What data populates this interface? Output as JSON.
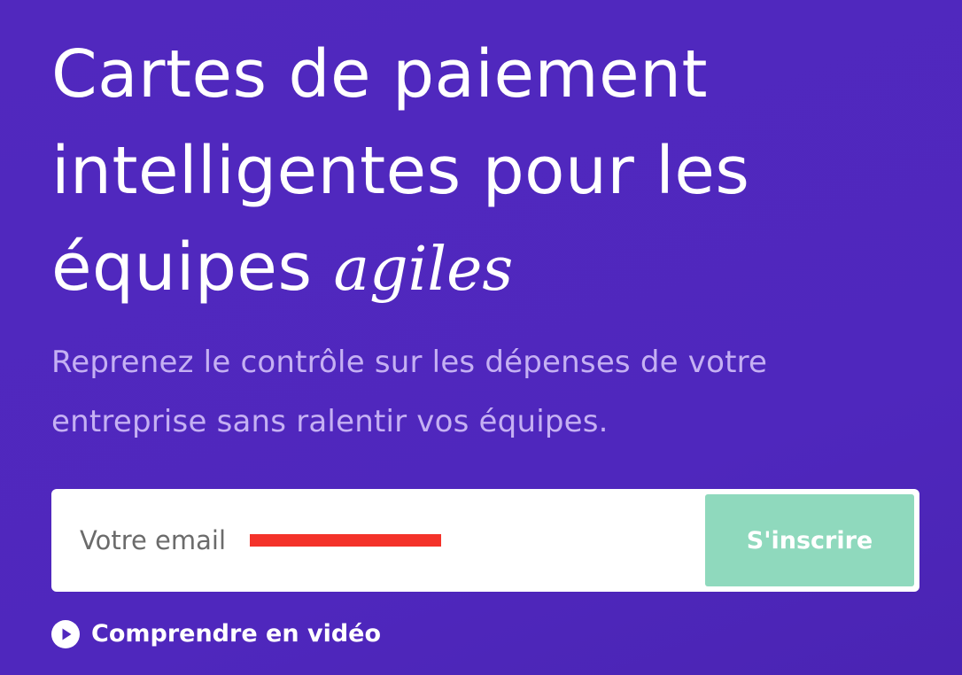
{
  "hero": {
    "headline": "Cartes de paiement intelligentes pour les équipes",
    "headline_accent": "agiles",
    "subtitle": "Reprenez le contrôle sur les dépenses de votre entreprise sans ralentir vos équipes."
  },
  "signup": {
    "email_placeholder": "Votre email",
    "email_value": "",
    "submit_label": "S'inscrire"
  },
  "video_link": {
    "label": "Comprendre en vidéo",
    "icon": "play-circle-icon"
  },
  "colors": {
    "background": "#5128be",
    "subtitle_text": "#c5b0f3",
    "submit_button": "#8fd9bd",
    "redaction": "#f4322a"
  }
}
